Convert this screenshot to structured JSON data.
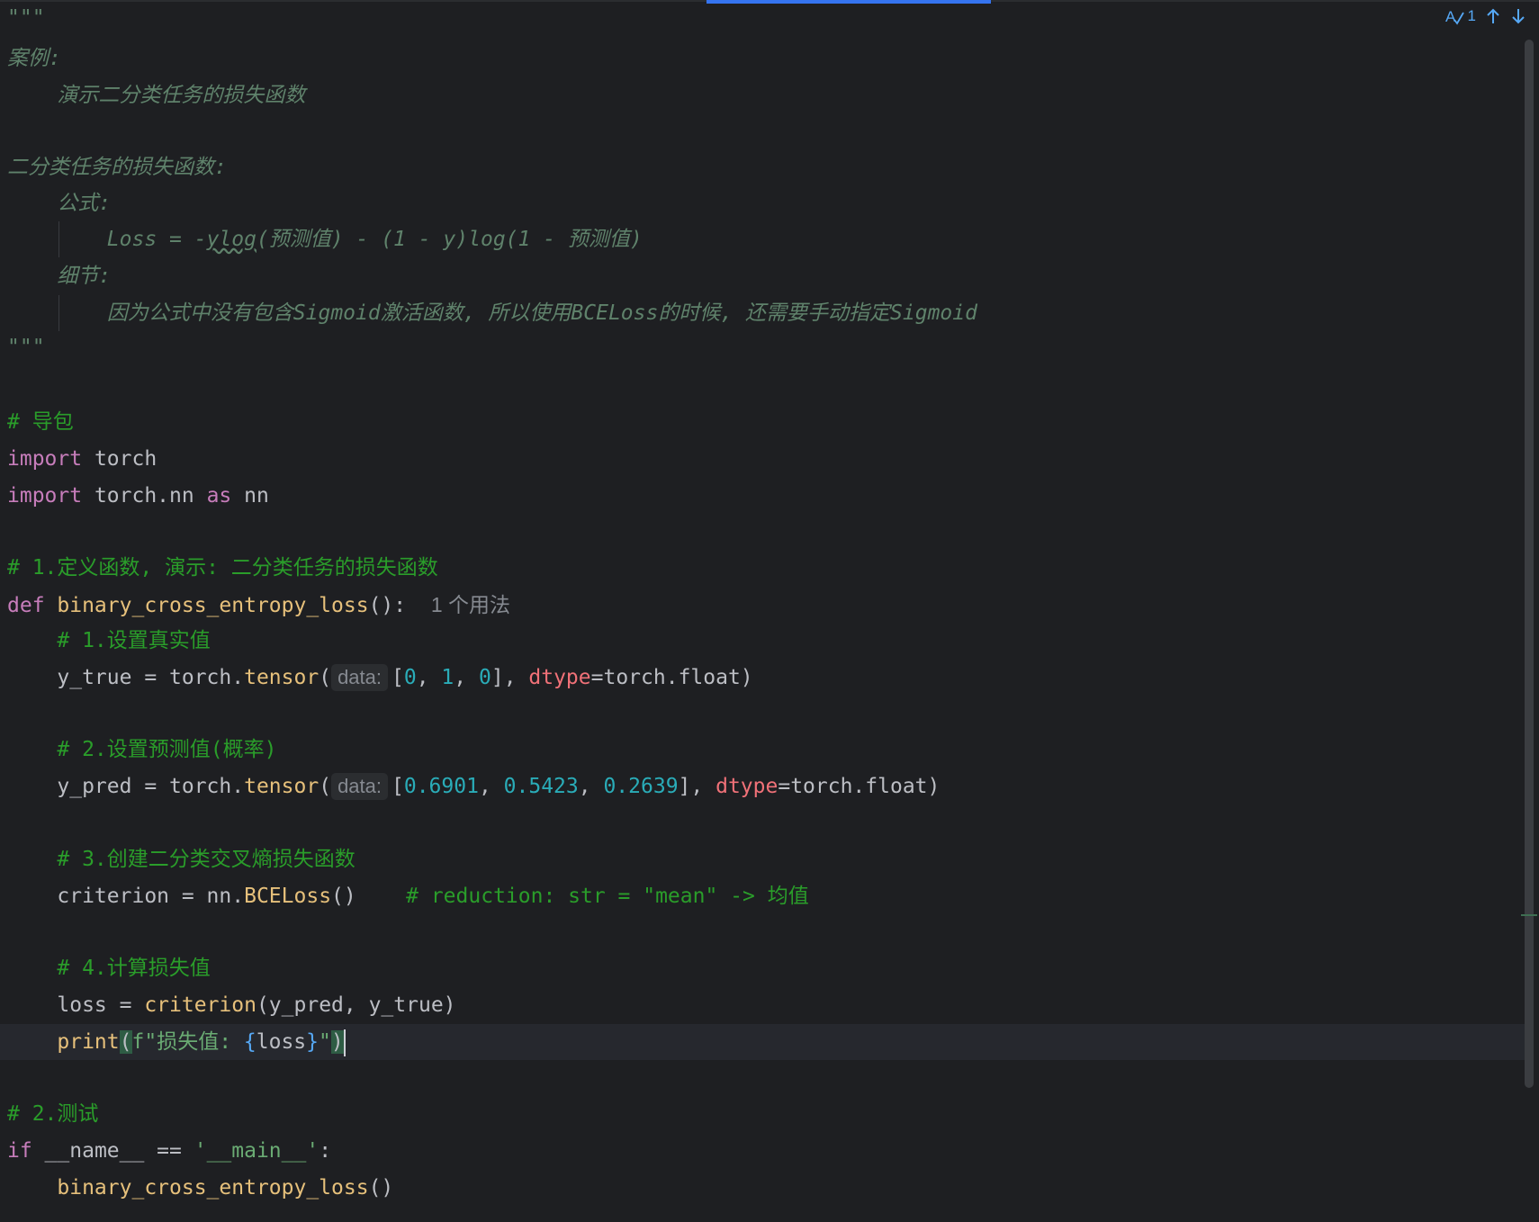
{
  "toolbar": {
    "inspection_count": "1",
    "inspection_icon": "typo-check-icon",
    "prev_icon": "arrow-up-icon",
    "next_icon": "arrow-down-icon"
  },
  "code": {
    "doc_open": "\"\"\"",
    "doc_l1": "案例:",
    "doc_l2": "    演示二分类任务的损失函数",
    "doc_l4": "二分类任务的损失函数:",
    "doc_l5": "    公式:",
    "doc_l6a": "        Loss = -",
    "doc_l6b": "ylog",
    "doc_l6c": "(预测值) - (1 - y)log(1 - 预测值)",
    "doc_l7": "    细节:",
    "doc_l8": "        因为公式中没有包含Sigmoid激活函数, 所以使用BCELoss的时候, 还需要手动指定Sigmoid",
    "doc_close": "\"\"\"",
    "c_import": "# 导包",
    "import_kw": "import",
    "torch": " torch",
    "torch_nn": " torch.nn ",
    "as_kw": "as",
    "nn": " nn",
    "c_def": "# 1.定义函数, 演示: 二分类任务的损失函数",
    "def_kw": "def",
    "func_name": " binary_cross_entropy_loss",
    "def_tail": "():",
    "usage": "1 个用法",
    "c_step1": "    # 1.设置真实值",
    "ytrue_lhs": "    y_true = torch.",
    "tensor": "tensor",
    "paren_open": "(",
    "hint_data": "data:",
    "bracket_open": "[",
    "v0": "0",
    "comma": ", ",
    "v1": "1",
    "v2": "0",
    "bracket_close": "], ",
    "dtype": "dtype",
    "dtype_val": "=torch.float)",
    "c_step2": "    # 2.设置预测值(概率)",
    "ypred_lhs": "    y_pred = torch.",
    "p0": "0.6901",
    "p1": "0.5423",
    "p2": "0.2639",
    "c_step3": "    # 3.创建二分类交叉熵损失函数",
    "crit_lhs": "    criterion = nn.",
    "bceloss": "BCELoss",
    "crit_tail": "()    ",
    "crit_comment": "# reduction: str = \"mean\" -> 均值",
    "c_step4": "    # 4.计算损失值",
    "loss_lhs": "    loss = ",
    "criterion_call": "criterion",
    "loss_args": "(y_pred, y_true)",
    "print_indent": "    ",
    "print_fn": "print",
    "print_open": "(",
    "fstr_prefix": "f",
    "fstr_a": "\"损失值: ",
    "fstr_brace_open": "{",
    "fstr_var": "loss",
    "fstr_brace_close": "}",
    "fstr_b": "\"",
    "print_close": ")",
    "c_test": "# 2.测试",
    "if_kw": "if",
    "if_cond": " __name__ == ",
    "main_str": "'__main__'",
    "colon": ":",
    "call_indent": "    ",
    "call_fn": "binary_cross_entropy_loss",
    "call_parens": "()"
  }
}
